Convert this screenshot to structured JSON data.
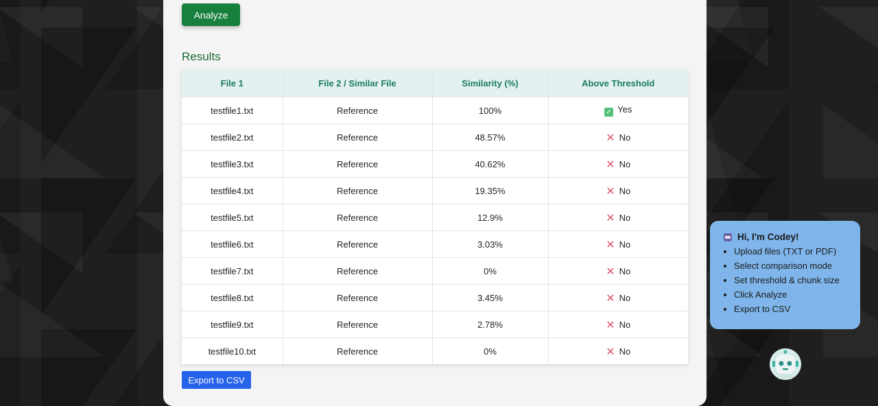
{
  "analyze_label": "Analyze",
  "results_title": "Results",
  "table": {
    "headers": [
      "File 1",
      "File 2 / Similar File",
      "Similarity (%)",
      "Above Threshold"
    ],
    "rows": [
      {
        "file1": "testfile1.txt",
        "file2": "Reference",
        "similarity": "100%",
        "above": "Yes"
      },
      {
        "file1": "testfile2.txt",
        "file2": "Reference",
        "similarity": "48.57%",
        "above": "No"
      },
      {
        "file1": "testfile3.txt",
        "file2": "Reference",
        "similarity": "40.62%",
        "above": "No"
      },
      {
        "file1": "testfile4.txt",
        "file2": "Reference",
        "similarity": "19.35%",
        "above": "No"
      },
      {
        "file1": "testfile5.txt",
        "file2": "Reference",
        "similarity": "12.9%",
        "above": "No"
      },
      {
        "file1": "testfile6.txt",
        "file2": "Reference",
        "similarity": "3.03%",
        "above": "No"
      },
      {
        "file1": "testfile7.txt",
        "file2": "Reference",
        "similarity": "0%",
        "above": "No"
      },
      {
        "file1": "testfile8.txt",
        "file2": "Reference",
        "similarity": "3.45%",
        "above": "No"
      },
      {
        "file1": "testfile9.txt",
        "file2": "Reference",
        "similarity": "2.78%",
        "above": "No"
      },
      {
        "file1": "testfile10.txt",
        "file2": "Reference",
        "similarity": "0%",
        "above": "No"
      }
    ]
  },
  "export_label": "Export to CSV",
  "assistant": {
    "title": "Hi, I'm Codey!",
    "tips": [
      "Upload files (TXT or PDF)",
      "Select comparison mode",
      "Set threshold & chunk size",
      "Click Analyze",
      "Export to CSV"
    ],
    "avatar_icon": "robot-icon"
  },
  "colors": {
    "primary_green": "#17803d",
    "export_blue": "#2563eb",
    "header_bg": "#e3f1f1",
    "header_text": "#1b7a64",
    "yes_icon": "#56c07a",
    "no_icon": "#e0526b",
    "bubble_bg": "#7fb5ea"
  }
}
